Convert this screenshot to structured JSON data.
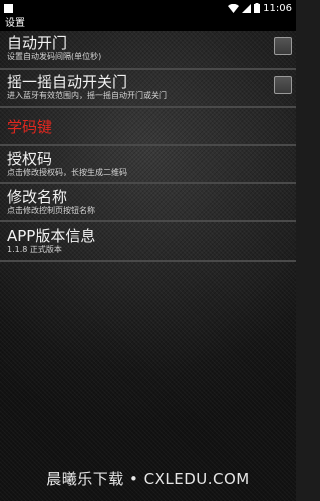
{
  "status_bar": {
    "time": "11:06",
    "icons": [
      "square-icon",
      "wifi-icon",
      "signal-icon",
      "battery-icon"
    ]
  },
  "app_bar": {
    "title": "设置"
  },
  "settings": {
    "auto_open": {
      "title": "自动开门",
      "summary": "设置自动发码间隔(单位秒)",
      "checked": false
    },
    "shake_open": {
      "title": "摇一摇自动开关门",
      "summary": "进入蓝牙有效范围内，摇一摇自动开门或关门",
      "checked": false
    },
    "section_header": "学码键",
    "auth_code": {
      "title": "授权码",
      "summary": "点击修改授权码，长按生成二维码"
    },
    "rename": {
      "title": "修改名称",
      "summary": "点击修改控制页按钮名称"
    },
    "version": {
      "title": "APP版本信息",
      "summary": "1.1.8 正式版本"
    }
  },
  "watermark": "晨曦乐下载 • CXLEDU.COM",
  "colors": {
    "section_header": "#e0271f",
    "divider": "#4a4a4a",
    "background": "#262626"
  }
}
